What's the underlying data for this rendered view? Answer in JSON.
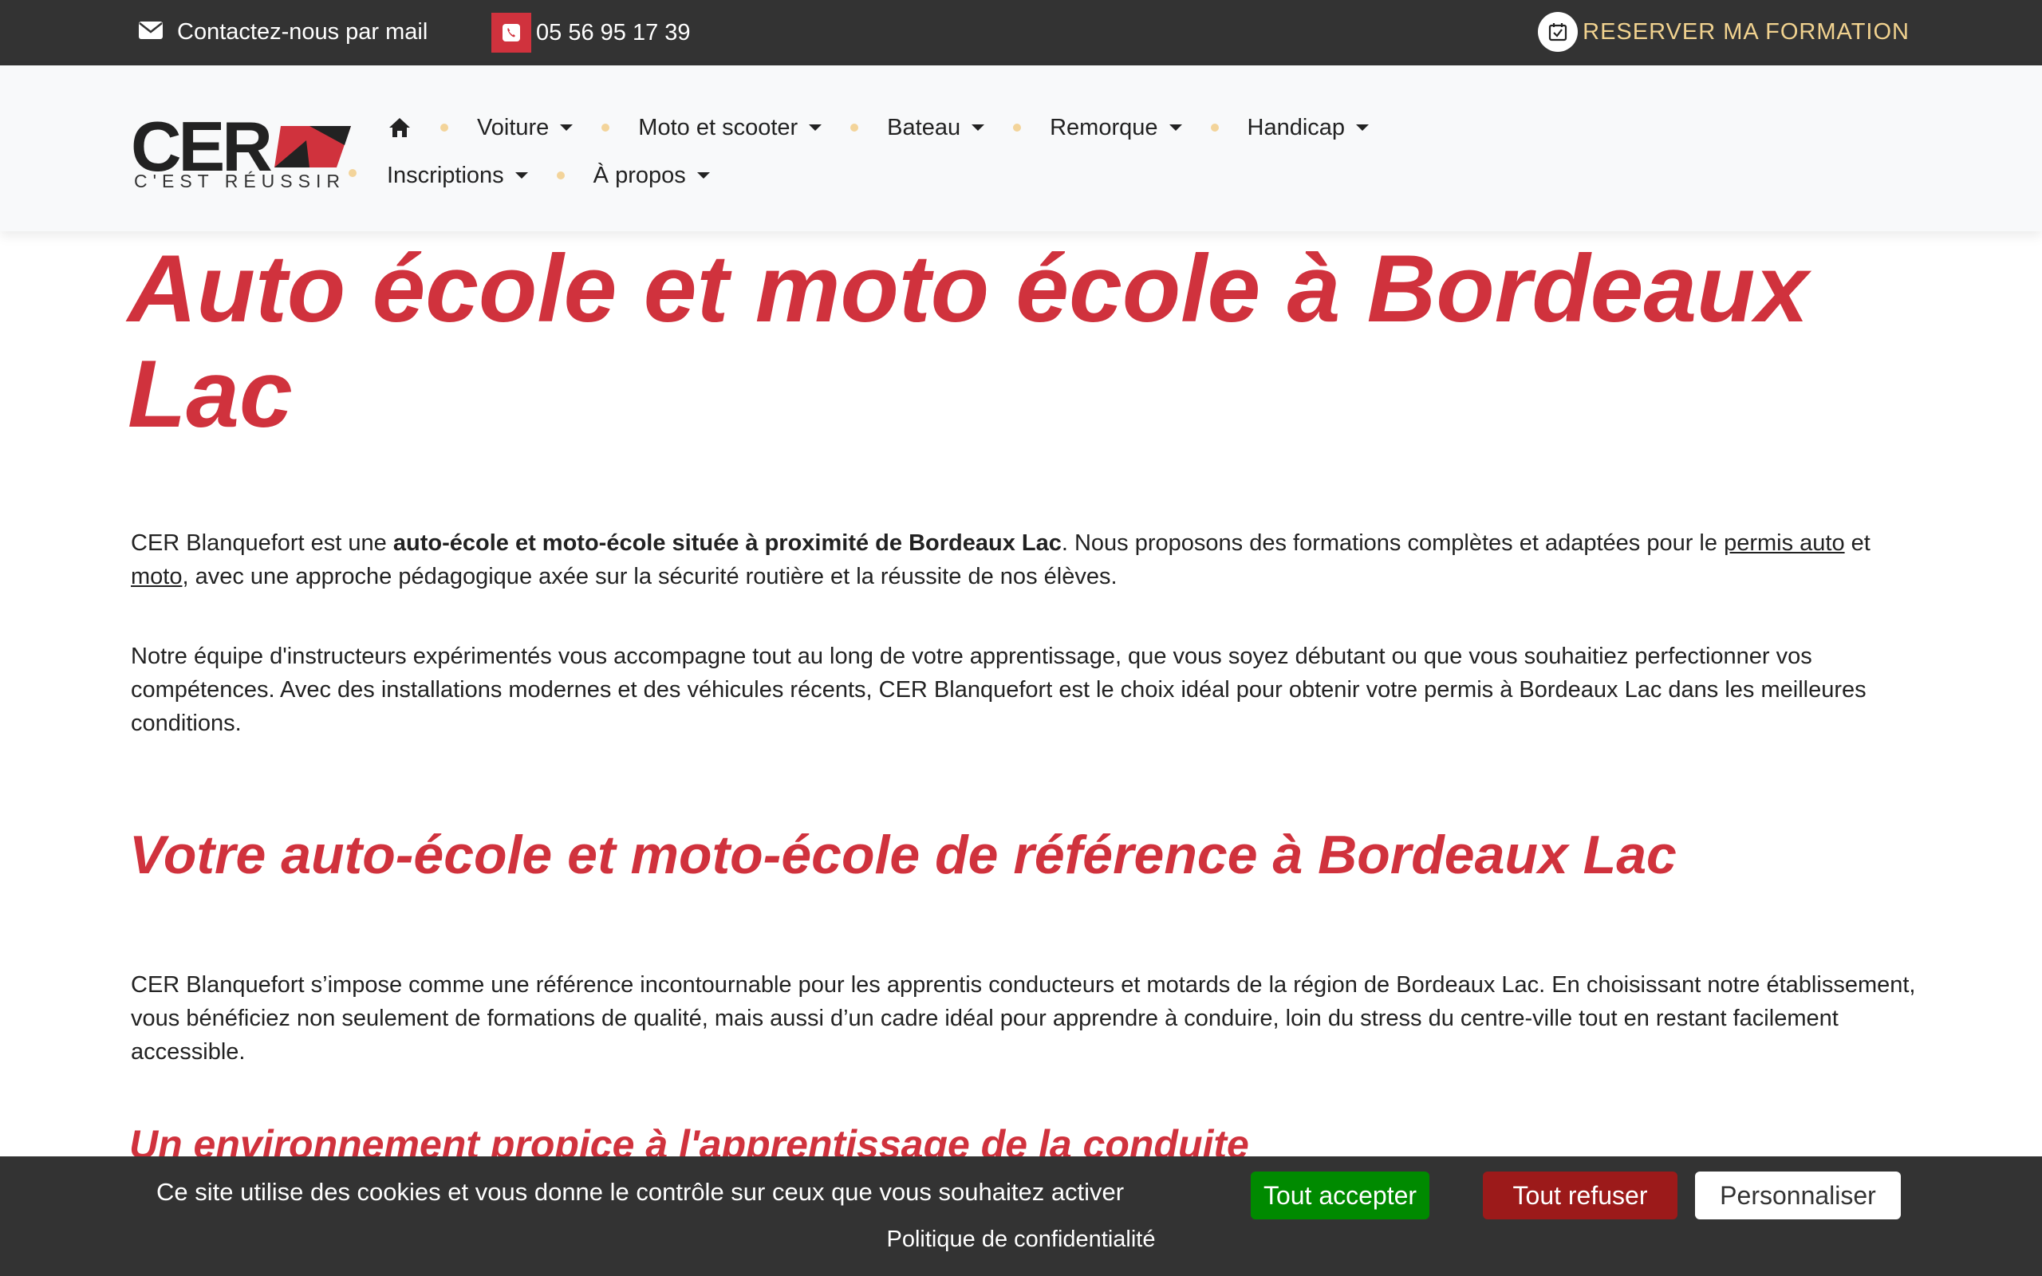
{
  "topbar": {
    "mail_label": "Contactez-nous par mail",
    "phone": "05 56 95 17 39",
    "reserve_label": "RESERVER MA FORMATION"
  },
  "logo": {
    "word": "CER",
    "tagline": "C'EST RÉUSSIR"
  },
  "nav": {
    "home_icon": "home-icon",
    "items": [
      {
        "label": "Voiture"
      },
      {
        "label": "Moto et scooter"
      },
      {
        "label": "Bateau"
      },
      {
        "label": "Remorque"
      },
      {
        "label": "Handicap"
      },
      {
        "label": "Inscriptions"
      },
      {
        "label": "À propos"
      }
    ]
  },
  "main": {
    "title": "Auto école et moto école à Bordeaux Lac",
    "p1": {
      "t1": "CER Blanquefort est une ",
      "bold": "auto-école et moto-école située à proximité de Bordeaux Lac",
      "t2": ". Nous proposons des formations complètes et adaptées pour le ",
      "link1": "permis auto",
      "t3": " et ",
      "link2": "moto",
      "t4": ", avec une approche pédagogique axée sur la sécurité routière et la réussite de nos élèves."
    },
    "p2": "Notre équipe d'instructeurs expérimentés vous accompagne tout au long de votre apprentissage, que vous soyez débutant ou que vous souhaitiez perfectionner vos compétences. Avec des installations modernes et des véhicules récents, CER Blanquefort est le choix idéal pour obtenir votre permis à Bordeaux Lac dans les meilleures conditions.",
    "h2": "Votre auto-école et moto-école de référence à Bordeaux Lac",
    "p3": "CER Blanquefort s’impose comme une référence incontournable pour les apprentis conducteurs et motards de la région de Bordeaux Lac. En choisissant notre établissement, vous bénéficiez non seulement de formations de qualité, mais aussi d’un cadre idéal pour apprendre à conduire, loin du stress du centre-ville tout en restant facilement accessible.",
    "h3": "Un environnement propice à l'apprentissage de la conduite"
  },
  "cookie": {
    "message": "Ce site utilise des cookies et vous donne le contrôle sur ceux que vous souhaitez activer",
    "accept": "Tout accepter",
    "refuse": "Tout refuser",
    "customize": "Personnaliser",
    "privacy": "Politique de confidentialité"
  },
  "colors": {
    "brand_red": "#d0323d",
    "dark_bar": "#333333",
    "gold": "#f1d28f",
    "accept_green": "#008a00",
    "refuse_red": "#9c1a1a"
  }
}
